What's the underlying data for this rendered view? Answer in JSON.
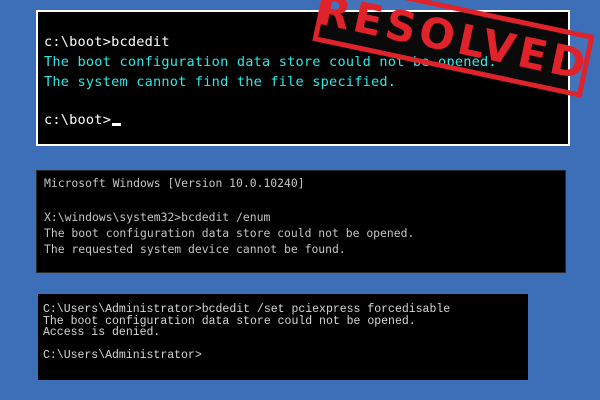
{
  "console_top": {
    "lines": [
      "c:\\boot>bcdedit",
      "The boot configuration data store could not be opened.",
      "The system cannot find the file specified.",
      "c:\\boot>"
    ]
  },
  "console_middle": {
    "lines": [
      "Microsoft Windows [Version 10.0.10240]",
      "X:\\windows\\system32>bcdedit /enum",
      "The boot configuration data store could not be opened.",
      "The requested system device cannot be found."
    ]
  },
  "console_bottom": {
    "lines": [
      "C:\\Users\\Administrator>bcdedit /set pciexpress forcedisable",
      "The boot configuration data store could not be opened.",
      "Access is denied.",
      "C:\\Users\\Administrator>"
    ]
  },
  "stamp": {
    "text": "RESOLVED"
  }
}
